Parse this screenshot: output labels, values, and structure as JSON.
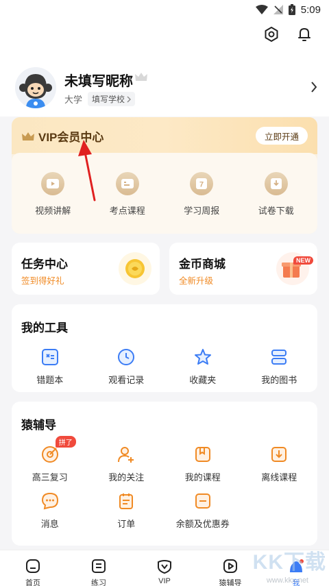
{
  "status_bar": {
    "time": "5:09"
  },
  "profile": {
    "nickname": "未填写昵称",
    "level": "大学",
    "school_chip": "填写学校"
  },
  "vip": {
    "title": "VIP会员中心",
    "open_button": "立即开通",
    "items": [
      {
        "label": "视频讲解",
        "icon": "play-icon"
      },
      {
        "label": "考点课程",
        "icon": "course-icon"
      },
      {
        "label": "学习周报",
        "icon": "calendar-icon"
      },
      {
        "label": "试卷下载",
        "icon": "download-icon"
      }
    ]
  },
  "task_center": {
    "title": "任务中心",
    "subtitle": "签到得好礼"
  },
  "coin_mall": {
    "title": "金币商城",
    "subtitle": "全新升级",
    "badge": "NEW"
  },
  "tools": {
    "title": "我的工具",
    "items": [
      {
        "label": "错题本",
        "icon": "wrong-book-icon"
      },
      {
        "label": "观看记录",
        "icon": "clock-icon"
      },
      {
        "label": "收藏夹",
        "icon": "star-icon"
      },
      {
        "label": "我的图书",
        "icon": "books-icon"
      }
    ]
  },
  "yuanfudao": {
    "title": "猿辅导",
    "badge": "拼了",
    "row1": [
      {
        "label": "高三复习",
        "icon": "target-icon"
      },
      {
        "label": "我的关注",
        "icon": "follow-icon"
      },
      {
        "label": "我的课程",
        "icon": "bookmark-icon"
      },
      {
        "label": "离线课程",
        "icon": "offline-download-icon"
      }
    ],
    "row2": [
      {
        "label": "消息",
        "icon": "message-icon"
      },
      {
        "label": "订单",
        "icon": "order-icon"
      },
      {
        "label": "余额及优惠券",
        "icon": "wallet-icon"
      }
    ]
  },
  "tabbar": [
    {
      "label": "首页",
      "icon": "home-icon"
    },
    {
      "label": "练习",
      "icon": "practice-icon"
    },
    {
      "label": "VIP",
      "icon": "vip-icon"
    },
    {
      "label": "猿辅导",
      "icon": "video-icon"
    },
    {
      "label": "我",
      "icon": "me-icon"
    }
  ],
  "watermark": {
    "text": "KK下载",
    "url": "www.kkx.net"
  },
  "colors": {
    "accent_orange": "#f08a24",
    "accent_blue": "#3b7cf5",
    "vip_gold": "#5a3a12",
    "badge_red": "#f04a3c"
  }
}
